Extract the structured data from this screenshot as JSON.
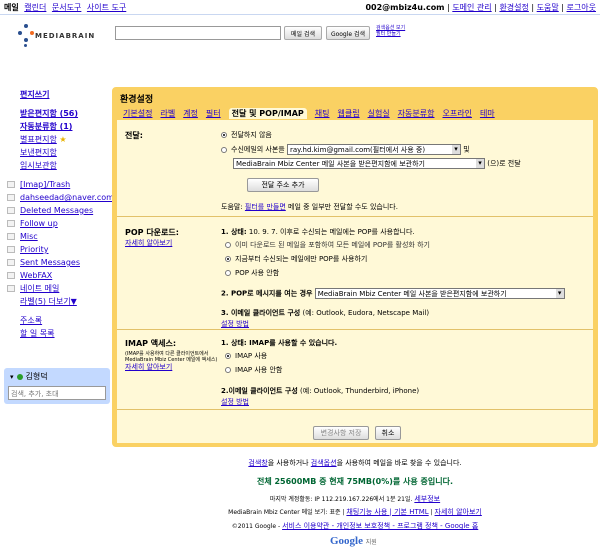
{
  "topnav": {
    "items": [
      "메일",
      "캘린더",
      "문서도구",
      "사이트 도구"
    ]
  },
  "account": {
    "email": "002@mbiz4u.com",
    "links": [
      "도메인 관리",
      "환경설정",
      "도움말",
      "로그아웃"
    ]
  },
  "brand": {
    "name": "MEDIABRAIN"
  },
  "search": {
    "mail_btn": "메일 검색",
    "web_btn": "Google 검색",
    "links": [
      "검색옵션 보기",
      "필터 만들기"
    ]
  },
  "sidebar": {
    "compose": "편지쓰기",
    "items": [
      "받은편지함 (56)",
      "자동분류함 (1)",
      "별표편지함",
      "보낸편지함",
      "임시보관함"
    ],
    "labels": [
      "[Imap]/Trash",
      "dahseedad@naver.com",
      "Deleted Messages",
      "Follow up",
      "Misc",
      "Priority",
      "Sent Messages",
      "WebFAX",
      "네이트 메일",
      "라벨(5) 더보기▼"
    ],
    "contacts": "주소록",
    "tasks": "할 일 목록"
  },
  "chat": {
    "user": "김형덕",
    "placeholder": "검색, 추가, 초대"
  },
  "settings": {
    "title": "환경설정",
    "tabs": [
      "기본설정",
      "라벨",
      "계정",
      "필터",
      "전달 및 POP/IMAP",
      "채팅",
      "웹클립",
      "실험실",
      "자동분류함",
      "오프라인",
      "테마"
    ],
    "active_tab_index": 4,
    "forward": {
      "label": "전달:",
      "opt1": "전달하지 않음",
      "opt2_prefix": "수신메일의 사본을",
      "opt2_address": "ray.hd.kim@gmail.com(필터에서 사용 중)",
      "opt2_and": "및",
      "opt2_action": "MediaBrain Mbiz Center 메일 사본을 받은편지함에 보관하기",
      "opt2_suffix": "(으)로 전달",
      "add_btn": "전달 주소 추가",
      "tip_prefix": "도움말: ",
      "tip_link": "필터를 만들면",
      "tip_suffix": " 메일 중 일부만 전달할 수도 있습니다."
    },
    "pop": {
      "label": "POP 다운로드:",
      "learn": "자세히 알아보기",
      "status_num": "1. 상태:",
      "status": "10. 9. 7. 이후로 수신되는 메일에는 POP를 사용합니다.",
      "opt1": "이미 다운로드 된 메일을 포함하여 모든 메일에 POP를 활성화 하기",
      "opt2": "지금부터 수신되는 메일에만 POP를 사용하기",
      "opt3": "POP 사용 안함",
      "step2": "2. POP로 메시지를 여는 경우",
      "step2_value": "MediaBrain Mbiz Center 메일 사본을 받은편지함에 보관하기",
      "step3": "3. 이메일 클라이언트 구성",
      "step3_detail": "(예: Outlook, Eudora, Netscape Mail)",
      "step3_link": "설정 방법"
    },
    "imap": {
      "label": "IMAP 액세스:",
      "sub": "(IMAP를 사용하여 다른 클라이언트에서 MediaBrain Mbiz Center 메일에 액세스)",
      "learn": "자세히 알아보기",
      "status": "1. 상태: IMAP를 사용할 수 있습니다.",
      "opt1": "IMAP 사용",
      "opt2": "IMAP 사용 안함",
      "step2": "2.이메일 클라이언트 구성",
      "step2_detail": "(예: Outlook, Thunderbird, iPhone)",
      "step2_link": "설정 방법"
    },
    "save_btn": "변경사항 저장",
    "cancel_btn": "취소"
  },
  "footer": {
    "line1_link1": "검색창",
    "line1_text1": "을 사용하거나 ",
    "line1_link2": "검색옵션",
    "line1_text2": "을 사용하여 메일을 바로 찾을 수 있습니다.",
    "usage": "전체 25600MB 중 현재 75MB(0%)를 사용 중입니다.",
    "activity": "마지막 계정활동: IP 112.219.167.226에서 1분 21일.",
    "activity_link": "세부정보",
    "view_prefix": "MediaBrain Mbiz Center 메일 보기: 표준 | ",
    "view_links": "채팅기능 사용 | 기본 HTML",
    "view_more": "자세히 알아보기",
    "copyright": "©2011 Google - ",
    "copyright_links": "서비스 이용약관 - 개인정보 보호정책 - 프로그램 정책 - Google 홈",
    "powered": "Google",
    "powered_suffix": "지원"
  }
}
